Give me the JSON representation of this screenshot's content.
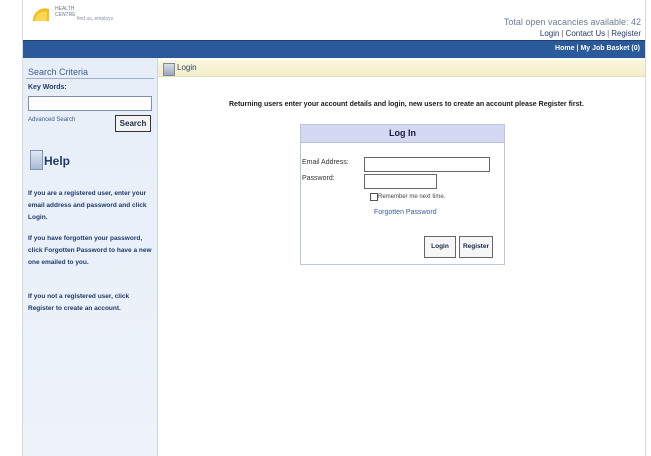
{
  "header": {
    "logo_text": "HEALTH CENTRE",
    "logo_tagline": "find us, employs",
    "vacancies_text": "Total open vacancies available: 42",
    "links": {
      "login": "Login",
      "contact": "Contact Us",
      "register": "Register"
    },
    "nav": {
      "home": "Home",
      "basket": "My Job Basket (0)"
    }
  },
  "sidebar": {
    "title": "Search Criteria",
    "keywords_label": "Key Words:",
    "keywords_value": "",
    "advanced_link": "Advanced Search",
    "search_button": "Search",
    "help_title": "Help",
    "help_paragraphs": [
      "If you are a registered user, enter your email address and password and click Login.",
      "If you have forgotten your password, click Forgotten Password to have a new one emailed to you.",
      "If you not a registered user, click Register to create an account."
    ]
  },
  "main": {
    "section_title": "Login",
    "instructions": "Returning users enter your account details and login, new users to create an account please Register first.",
    "panel": {
      "title": "Log In",
      "email_label": "Email Address:",
      "email_value": "",
      "password_label": "Password:",
      "password_value": "",
      "remember_label": "Remember me next time.",
      "remember_checked": false,
      "forgot_link": "Forgotten Password",
      "login_button": "Login",
      "register_button": "Register"
    }
  },
  "colors": {
    "nav_blue": "#2b5a9a",
    "panel_head": "#d4d8f2",
    "sidebar_bg": "#e7eef8",
    "title_bar": "#f3eec6"
  },
  "icons": {
    "logo": "sun-logo-icon",
    "help": "help-book-icon",
    "login": "login-page-icon"
  }
}
